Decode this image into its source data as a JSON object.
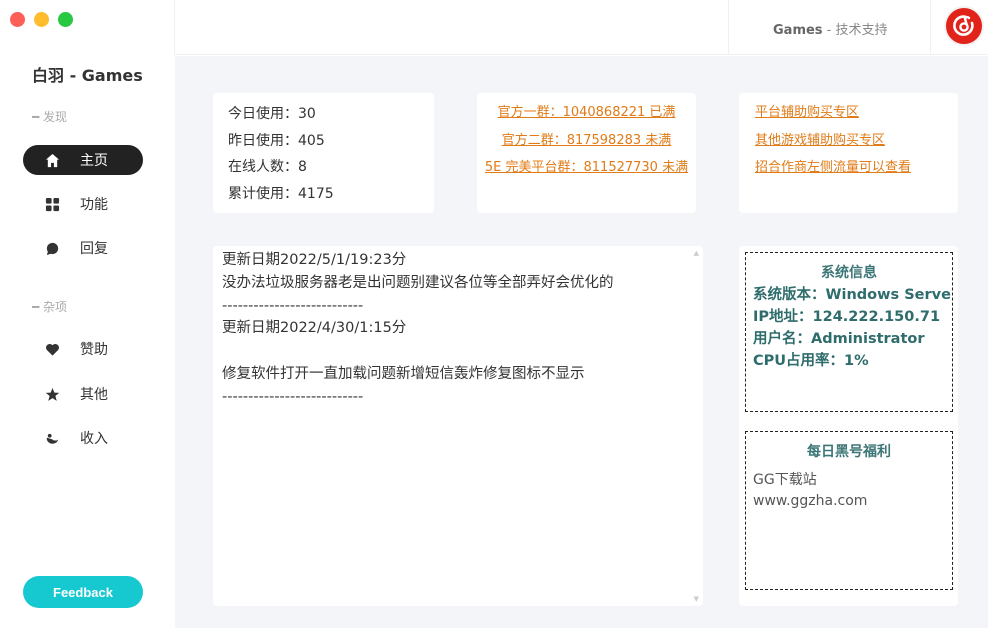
{
  "app": {
    "title": "白羽 - Games"
  },
  "sidebar": {
    "section_discover": "发现",
    "section_misc": "杂项",
    "items": [
      {
        "label": "主页",
        "icon": "home-icon",
        "active": true
      },
      {
        "label": "功能",
        "icon": "grid-icon",
        "active": false
      },
      {
        "label": "回复",
        "icon": "chat-icon",
        "active": false
      },
      {
        "label": "赞助",
        "icon": "heart-icon",
        "active": false
      },
      {
        "label": "其他",
        "icon": "star-icon",
        "active": false
      },
      {
        "label": "收入",
        "icon": "wallet-icon",
        "active": false
      }
    ],
    "feedback_label": "Feedback"
  },
  "header": {
    "brand": "Games",
    "separator": " - ",
    "support": "技术支持",
    "logo_icon": "netease-music-icon",
    "logo_color": "#e2231a"
  },
  "stats": {
    "today": "今日使用：30",
    "yesterday": "昨日使用：405",
    "online": "在线人数：8",
    "total": "累计使用：4175"
  },
  "groups": {
    "group1": "官方一群：1040868221 已满",
    "group2": "官方二群：817598283 未满",
    "group3": "5E 完美平台群：811527730 未满"
  },
  "links": {
    "link1": "平台辅助购买专区",
    "link2": "其他游戏辅助购买专区",
    "link3": "招合作商左侧流量可以查看"
  },
  "notes": {
    "text": "更新日期2022/5/1/19:23分\n没办法垃圾服务器老是出问题别建议各位等全部弄好会优化的\n---------------------------\n更新日期2022/4/30/1:15分\n\n修复软件打开一直加载问题新增短信轰炸修复图标不显示\n---------------------------"
  },
  "sysinfo": {
    "title": "系统信息",
    "version": "系统版本：Windows Serve",
    "ip": "IP地址：124.222.150.71",
    "user": "用户名：Administrator",
    "cpu": "CPU占用率：1%"
  },
  "daily": {
    "title": "每日黑号福利",
    "line1": "GG下载站",
    "line2": "www.ggzha.com"
  },
  "colors": {
    "accent": "#16c9d0",
    "link": "#e07b17",
    "sys_text": "#2f6c6c"
  }
}
